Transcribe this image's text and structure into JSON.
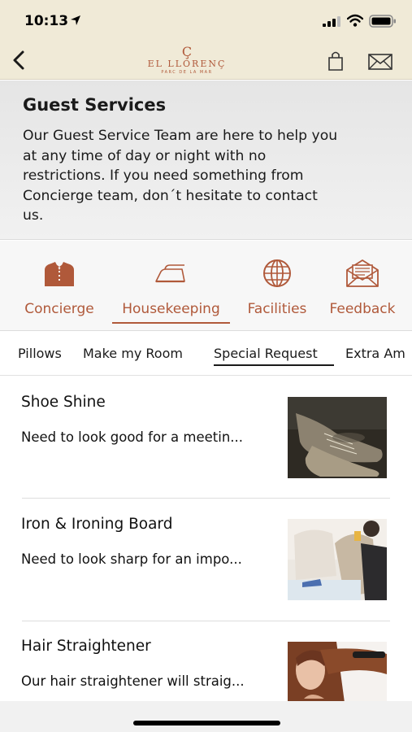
{
  "status": {
    "time": "10:13"
  },
  "nav": {
    "logo_mark": "Ç",
    "logo_name": "EL LLORENÇ",
    "logo_sub": "PARC DE LA MAR"
  },
  "intro": {
    "title": "Guest Services",
    "lines": [
      "Our Guest Service Team are here to help you",
      "at any time of day or night with no",
      "restrictions. If you need something from",
      "Concierge team, don´t hesitate to contact",
      "us."
    ]
  },
  "categories": [
    {
      "label": "Concierge",
      "icon": "butler-icon",
      "active": false
    },
    {
      "label": "Housekeeping",
      "icon": "iron-icon",
      "active": true
    },
    {
      "label": "Facilities",
      "icon": "globe-icon",
      "active": false
    },
    {
      "label": "Feedback",
      "icon": "envelope-letter-icon",
      "active": false
    }
  ],
  "subtabs": [
    {
      "label": "Pillows",
      "active": false
    },
    {
      "label": "Make my Room",
      "active": false
    },
    {
      "label": "Special Request",
      "active": true
    },
    {
      "label": "Extra Am",
      "active": false
    }
  ],
  "items": [
    {
      "title": "Shoe Shine",
      "description": "Need to look good for a meetin...",
      "image": "shoes-photo"
    },
    {
      "title": "Iron & Ironing Board",
      "description": "Need to look sharp for an impo...",
      "image": "ironing-photo"
    },
    {
      "title": "Hair Straightener",
      "description": "Our hair straightener will straig...",
      "image": "hair-photo"
    }
  ],
  "colors": {
    "accent": "#b0593a",
    "header_bg": "#f0ead7"
  }
}
